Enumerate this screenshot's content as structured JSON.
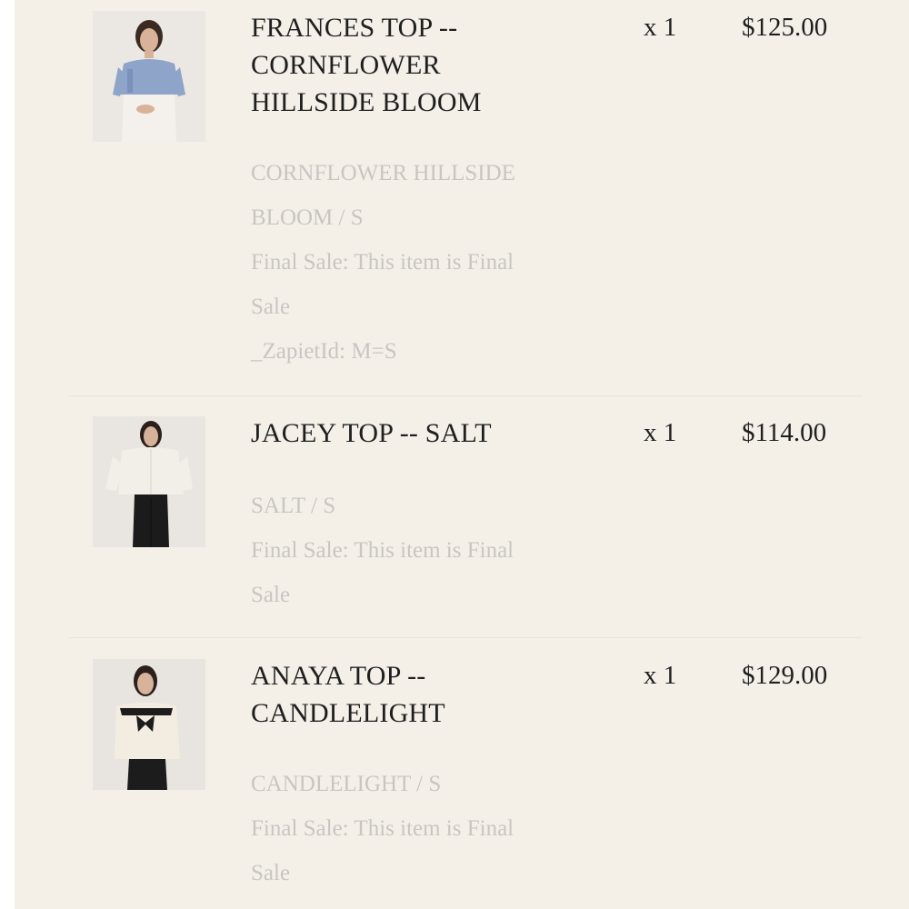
{
  "items": [
    {
      "title_lines": [
        "FRANCES TOP --",
        "CORNFLOWER",
        "HILLSIDE BLOOM"
      ],
      "quantity": "x 1",
      "price": "$125.00",
      "meta_lines": [
        "CORNFLOWER HILLSIDE",
        "BLOOM / S",
        "Final Sale: This item is Final",
        "Sale",
        "_ZapietId: M=S"
      ],
      "image": {
        "top_color": "#8ea4c8",
        "bottom_color": "#f4f1ec",
        "bg": "#ebe7e2"
      }
    },
    {
      "title_lines": [
        "JACEY TOP -- SALT"
      ],
      "quantity": "x 1",
      "price": "$114.00",
      "meta_lines": [
        "SALT / S",
        "Final Sale: This item is Final",
        "Sale"
      ],
      "image": {
        "top_color": "#f2efe9",
        "bottom_color": "#1c1b1b",
        "bg": "#e9e5e0"
      }
    },
    {
      "title_lines": [
        "ANAYA TOP --",
        "CANDLELIGHT"
      ],
      "quantity": "x 1",
      "price": "$129.00",
      "meta_lines": [
        "CANDLELIGHT / S",
        "Final Sale: This item is Final",
        "Sale"
      ],
      "image": {
        "top_color": "#f3ede1",
        "bottom_color": "#1d1c1c",
        "bg": "#e8e4df"
      }
    }
  ]
}
